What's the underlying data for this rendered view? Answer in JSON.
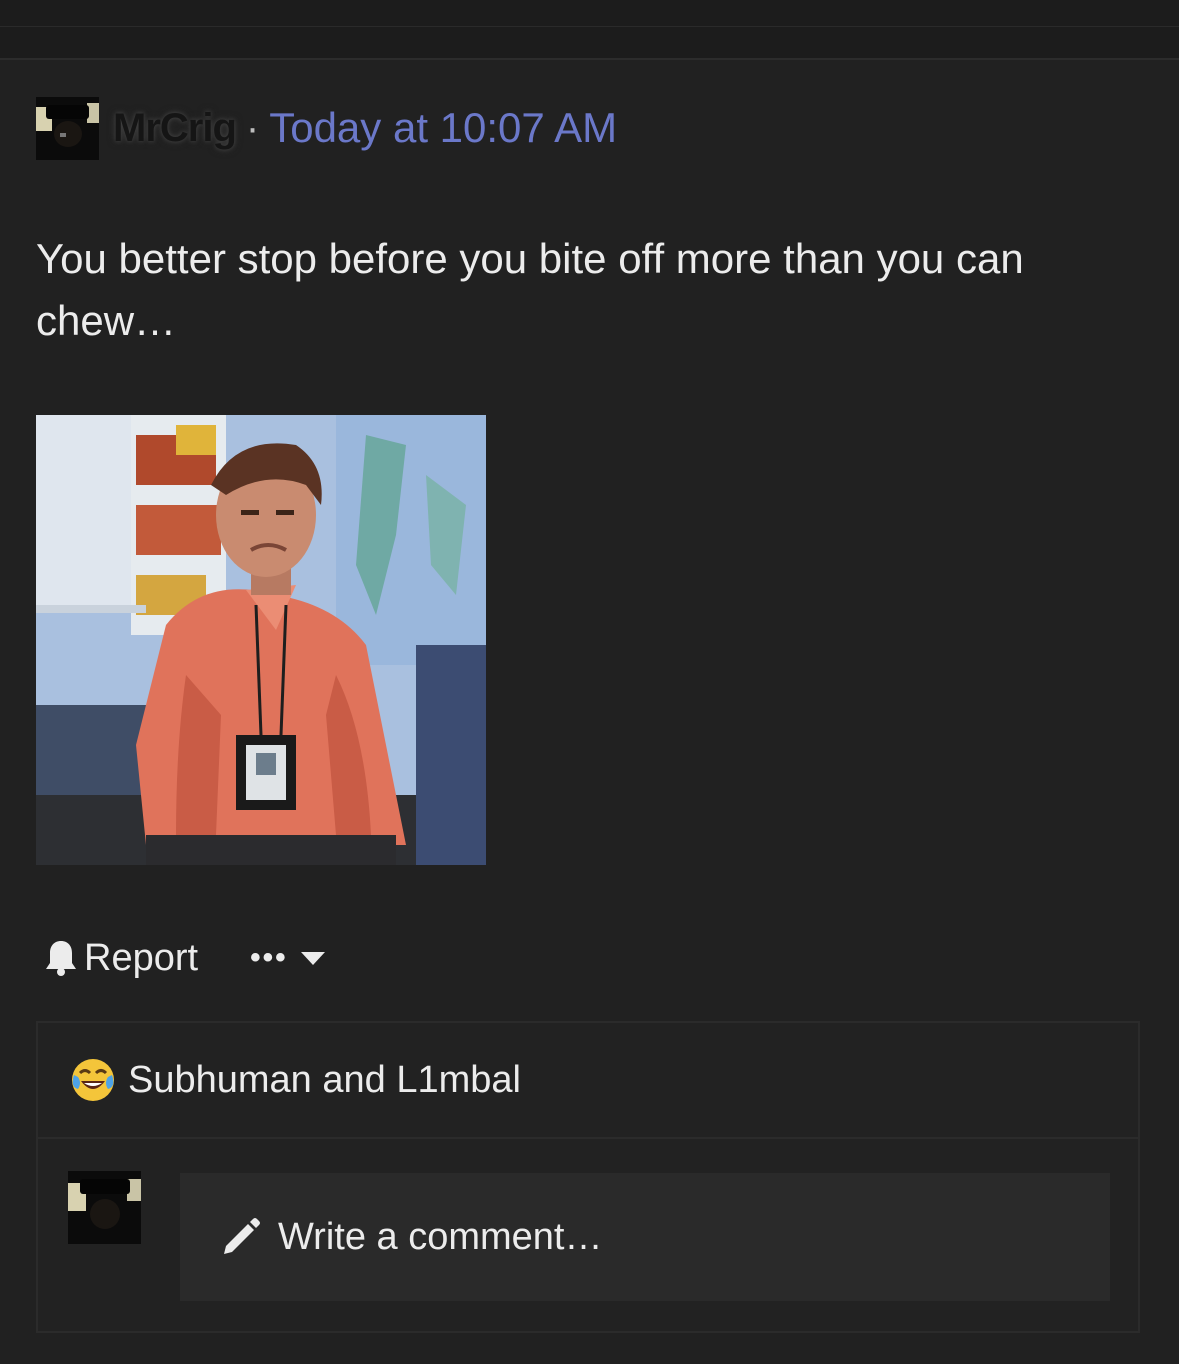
{
  "post": {
    "username": "MrCrig",
    "separator": "·",
    "timestamp": "Today at 10:07 AM",
    "message": "You better stop before you bite off more than you can chew…"
  },
  "actions": {
    "report_label": "Report",
    "more_label": "•••"
  },
  "reactions": {
    "emoji": "😂",
    "names": "Subhuman and L1mbal"
  },
  "comment": {
    "placeholder": "Write a comment…"
  },
  "colors": {
    "background": "#212121",
    "timestamp": "#6b78c9",
    "text": "#ececec"
  },
  "icons": [
    "bell-icon",
    "ellipsis-icon",
    "caret-down-icon",
    "pencil-icon",
    "crying-laughing-emoji"
  ]
}
